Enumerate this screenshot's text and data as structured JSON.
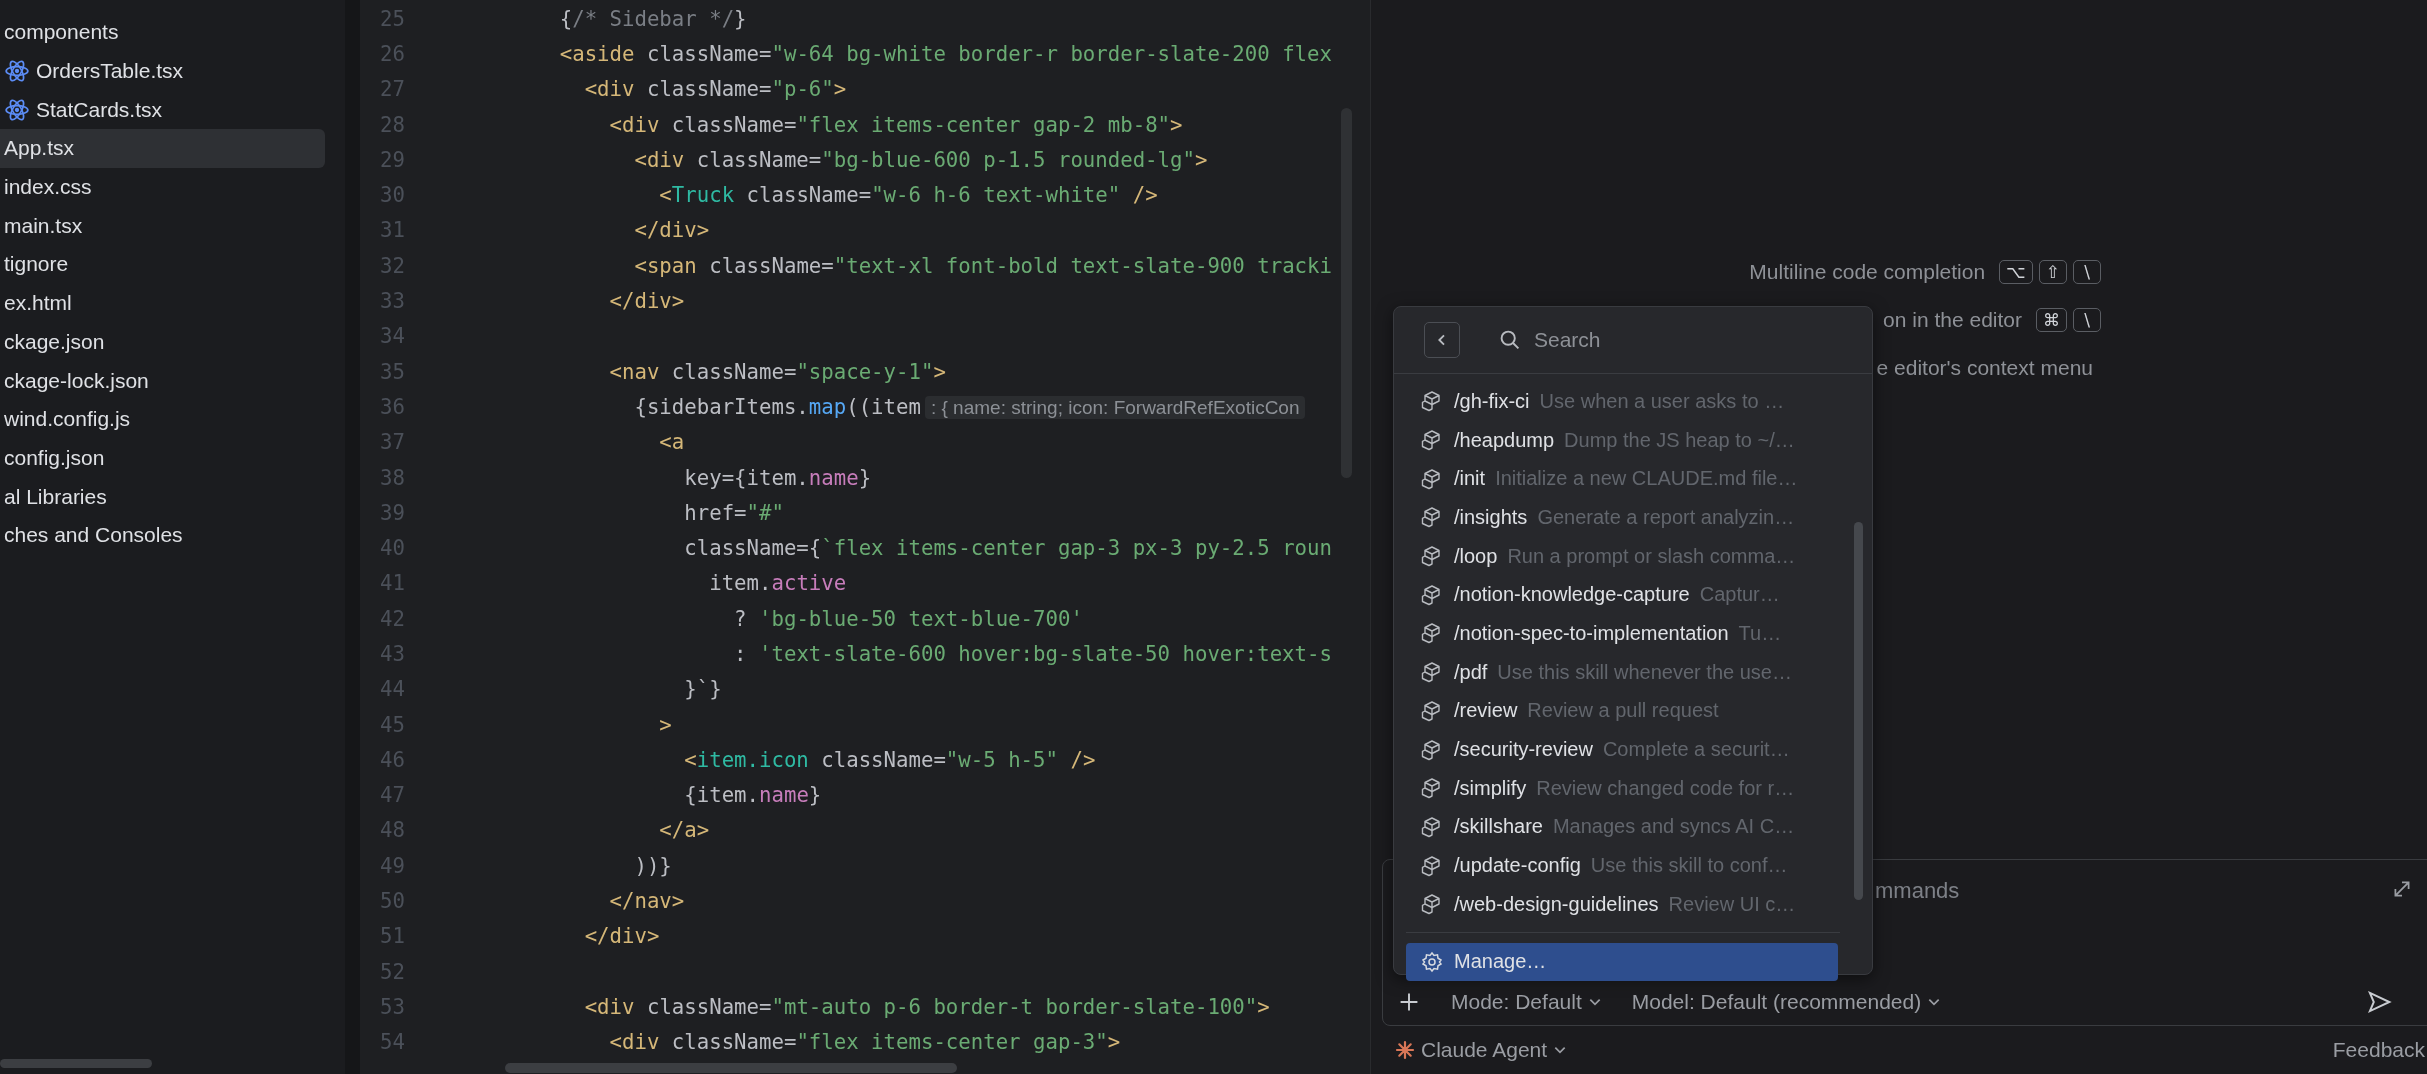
{
  "project_tree": [
    {
      "label": "components",
      "kind": "folder",
      "selected": false
    },
    {
      "label": "OrdersTable.tsx",
      "kind": "react",
      "selected": false
    },
    {
      "label": "StatCards.tsx",
      "kind": "react",
      "selected": false
    },
    {
      "label": "App.tsx",
      "kind": "file",
      "selected": true
    },
    {
      "label": "index.css",
      "kind": "file",
      "selected": false
    },
    {
      "label": "main.tsx",
      "kind": "file",
      "selected": false
    },
    {
      "label": "tignore",
      "kind": "file",
      "selected": false
    },
    {
      "label": "ex.html",
      "kind": "file",
      "selected": false
    },
    {
      "label": "ckage.json",
      "kind": "file",
      "selected": false
    },
    {
      "label": "ckage-lock.json",
      "kind": "file",
      "selected": false
    },
    {
      "label": "wind.config.js",
      "kind": "file",
      "selected": false
    },
    {
      "label": "config.json",
      "kind": "file",
      "selected": false
    },
    {
      "label": "al Libraries",
      "kind": "folder",
      "selected": false
    },
    {
      "label": "ches and Consoles",
      "kind": "folder",
      "selected": false
    }
  ],
  "editor": {
    "lines": [
      {
        "number": "25",
        "tokens": [
          {
            "kind": "plain",
            "text": "      {"
          },
          {
            "kind": "comment",
            "text": "/* Sidebar */"
          },
          {
            "kind": "plain",
            "text": "}"
          }
        ]
      },
      {
        "number": "26",
        "tokens": [
          {
            "kind": "tag",
            "text": "      <aside "
          },
          {
            "kind": "plain",
            "text": "className="
          },
          {
            "kind": "str",
            "text": "\"w-64 bg-white border-r border-slate-200 flex"
          }
        ]
      },
      {
        "number": "27",
        "tokens": [
          {
            "kind": "tag",
            "text": "        <div "
          },
          {
            "kind": "plain",
            "text": "className="
          },
          {
            "kind": "str",
            "text": "\"p-6\""
          },
          {
            "kind": "tag",
            "text": ">"
          }
        ]
      },
      {
        "number": "28",
        "tokens": [
          {
            "kind": "tag",
            "text": "          <div "
          },
          {
            "kind": "plain",
            "text": "className="
          },
          {
            "kind": "str",
            "text": "\"flex items-center gap-2 mb-8\""
          },
          {
            "kind": "tag",
            "text": ">"
          }
        ]
      },
      {
        "number": "29",
        "tokens": [
          {
            "kind": "tag",
            "text": "            <div "
          },
          {
            "kind": "plain",
            "text": "className="
          },
          {
            "kind": "str",
            "text": "\"bg-blue-600 p-1.5 rounded-lg\""
          },
          {
            "kind": "tag",
            "text": ">"
          }
        ]
      },
      {
        "number": "30",
        "tokens": [
          {
            "kind": "tag",
            "text": "              <"
          },
          {
            "kind": "comp",
            "text": "Truck "
          },
          {
            "kind": "plain",
            "text": "className="
          },
          {
            "kind": "str",
            "text": "\"w-6 h-6 text-white\" "
          },
          {
            "kind": "tag",
            "text": "/>"
          }
        ]
      },
      {
        "number": "31",
        "tokens": [
          {
            "kind": "tag",
            "text": "            </div>"
          }
        ]
      },
      {
        "number": "32",
        "tokens": [
          {
            "kind": "tag",
            "text": "            <span "
          },
          {
            "kind": "plain",
            "text": "className="
          },
          {
            "kind": "str",
            "text": "\"text-xl font-bold text-slate-900 tracki"
          }
        ]
      },
      {
        "number": "33",
        "tokens": [
          {
            "kind": "tag",
            "text": "          </div>"
          }
        ]
      },
      {
        "number": "34"
      },
      {
        "number": "35",
        "tokens": [
          {
            "kind": "tag",
            "text": "          <nav "
          },
          {
            "kind": "plain",
            "text": "className="
          },
          {
            "kind": "str",
            "text": "\"space-y-1\""
          },
          {
            "kind": "tag",
            "text": ">"
          }
        ]
      },
      {
        "number": "36",
        "tokens": [
          {
            "kind": "plain",
            "text": "            {sidebarItems."
          },
          {
            "kind": "fn",
            "text": "map"
          },
          {
            "kind": "plain",
            "text": "((item"
          },
          {
            "kind": "hint",
            "text": ": { name: string; icon: ForwardRefExoticCon"
          }
        ]
      },
      {
        "number": "37",
        "tokens": [
          {
            "kind": "tag",
            "text": "              <a"
          }
        ]
      },
      {
        "number": "38",
        "tokens": [
          {
            "kind": "plain",
            "text": "                key={item."
          },
          {
            "kind": "prop",
            "text": "name"
          },
          {
            "kind": "plain",
            "text": "}"
          }
        ]
      },
      {
        "number": "39",
        "tokens": [
          {
            "kind": "plain",
            "text": "                href="
          },
          {
            "kind": "str",
            "text": "\"#\""
          }
        ]
      },
      {
        "number": "40",
        "tokens": [
          {
            "kind": "plain",
            "text": "                className={"
          },
          {
            "kind": "str",
            "text": "`flex items-center gap-3 px-3 py-2.5 roun"
          }
        ]
      },
      {
        "number": "41",
        "tokens": [
          {
            "kind": "plain",
            "text": "                  item."
          },
          {
            "kind": "prop",
            "text": "active"
          }
        ]
      },
      {
        "number": "42",
        "tokens": [
          {
            "kind": "plain",
            "text": "                    ? "
          },
          {
            "kind": "str",
            "text": "'bg-blue-50 text-blue-700'"
          }
        ]
      },
      {
        "number": "43",
        "tokens": [
          {
            "kind": "plain",
            "text": "                    : "
          },
          {
            "kind": "str",
            "text": "'text-slate-600 hover:bg-slate-50 hover:text-s"
          }
        ]
      },
      {
        "number": "44",
        "tokens": [
          {
            "kind": "plain",
            "text": "                }`}"
          }
        ]
      },
      {
        "number": "45",
        "tokens": [
          {
            "kind": "tag",
            "text": "              >"
          }
        ]
      },
      {
        "number": "46",
        "tokens": [
          {
            "kind": "tag",
            "text": "                <"
          },
          {
            "kind": "comp",
            "text": "item.icon "
          },
          {
            "kind": "plain",
            "text": "className="
          },
          {
            "kind": "str",
            "text": "\"w-5 h-5\" "
          },
          {
            "kind": "tag",
            "text": "/>"
          }
        ]
      },
      {
        "number": "47",
        "tokens": [
          {
            "kind": "plain",
            "text": "                {item."
          },
          {
            "kind": "prop",
            "text": "name"
          },
          {
            "kind": "plain",
            "text": "}"
          }
        ]
      },
      {
        "number": "48",
        "tokens": [
          {
            "kind": "tag",
            "text": "              </a>"
          }
        ]
      },
      {
        "number": "49",
        "tokens": [
          {
            "kind": "plain",
            "text": "            ))}"
          }
        ]
      },
      {
        "number": "50",
        "tokens": [
          {
            "kind": "tag",
            "text": "          </nav>"
          }
        ]
      },
      {
        "number": "51",
        "tokens": [
          {
            "kind": "tag",
            "text": "        </div>"
          }
        ]
      },
      {
        "number": "52"
      },
      {
        "number": "53",
        "tokens": [
          {
            "kind": "tag",
            "text": "        <div "
          },
          {
            "kind": "plain",
            "text": "className="
          },
          {
            "kind": "str",
            "text": "\"mt-auto p-6 border-t border-slate-100\""
          },
          {
            "kind": "tag",
            "text": ">"
          }
        ]
      },
      {
        "number": "54",
        "tokens": [
          {
            "kind": "tag",
            "text": "          <div "
          },
          {
            "kind": "plain",
            "text": "className="
          },
          {
            "kind": "str",
            "text": "\"flex items-center gap-3\""
          },
          {
            "kind": "tag",
            "text": ">"
          }
        ]
      }
    ]
  },
  "shortcut_hints": [
    {
      "text": "Multiline code completion",
      "keys": [
        "⌥",
        "⇧",
        "\\"
      ]
    },
    {
      "text": "on in the editor",
      "keys": [
        "⌘",
        "\\"
      ]
    },
    {
      "text": "e editor's context menu"
    }
  ],
  "command_popup": {
    "search": {
      "placeholder": "Search"
    },
    "items": [
      {
        "name": "/gh-fix-ci",
        "description": "Use when a user asks to …",
        "selected": false
      },
      {
        "name": "/heapdump",
        "description": "Dump the JS heap to ~/…",
        "selected": false
      },
      {
        "name": "/init",
        "description": "Initialize a new CLAUDE.md file…",
        "selected": false
      },
      {
        "name": "/insights",
        "description": "Generate a report analyzin…",
        "selected": false
      },
      {
        "name": "/loop",
        "description": "Run a prompt or slash comma…",
        "selected": false
      },
      {
        "name": "/notion-knowledge-capture",
        "description": "Captur…",
        "selected": false
      },
      {
        "name": "/notion-spec-to-implementation",
        "description": "Tu…",
        "selected": false
      },
      {
        "name": "/pdf",
        "description": "Use this skill whenever the use…",
        "selected": false
      },
      {
        "name": "/review",
        "description": "Review a pull request",
        "selected": false
      },
      {
        "name": "/security-review",
        "description": "Complete a securit…",
        "selected": false
      },
      {
        "name": "/simplify",
        "description": "Review changed code for r…",
        "selected": false
      },
      {
        "name": "/skillshare",
        "description": "Manages and syncs AI C…",
        "selected": false
      },
      {
        "name": "/update-config",
        "description": "Use this skill to conf…",
        "selected": false
      },
      {
        "name": "/web-design-guidelines",
        "description": "Review UI c…",
        "selected": false
      }
    ],
    "manage": {
      "label": "Manage…",
      "selected": true
    }
  },
  "chat_input": {
    "placeholder": "mmands",
    "mode": "Mode: Default",
    "model": "Model: Default (recommended)"
  },
  "footer": {
    "agent": "Claude Agent",
    "feedback": "Feedback"
  }
}
